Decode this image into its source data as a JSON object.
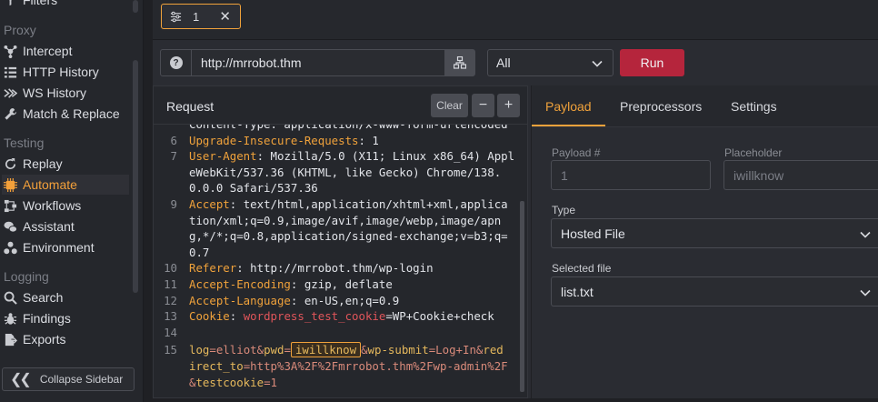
{
  "sidebar": {
    "partial_top_item": "Filters",
    "sections": {
      "proxy": "Proxy",
      "testing": "Testing",
      "logging": "Logging"
    },
    "items": [
      {
        "label": "Intercept",
        "icon": "proxy-icon"
      },
      {
        "label": "HTTP History",
        "icon": "list-icon"
      },
      {
        "label": "WS History",
        "icon": "websocket-icon"
      },
      {
        "label": "Match & Replace",
        "icon": "wrench-icon"
      },
      {
        "label": "Replay",
        "icon": "replay-icon"
      },
      {
        "label": "Automate",
        "icon": "automate-icon",
        "active": true
      },
      {
        "label": "Workflows",
        "icon": "workflow-icon"
      },
      {
        "label": "Assistant",
        "icon": "chat-icon"
      },
      {
        "label": "Environment",
        "icon": "environment-icon"
      },
      {
        "label": "Search",
        "icon": "search-icon"
      },
      {
        "label": "Findings",
        "icon": "bug-icon"
      },
      {
        "label": "Exports",
        "icon": "export-icon"
      }
    ],
    "collapse_label": "Collapse Sidebar"
  },
  "tabs": [
    {
      "label": "1",
      "icon": "sliders-icon"
    }
  ],
  "toolbar": {
    "url": "http://mrrobot.thm",
    "help_glyph": "?",
    "filter_value": "All",
    "run_label": "Run"
  },
  "request": {
    "title": "Request",
    "clear_label": "Clear",
    "minus_label": "−",
    "plus_label": "+",
    "top_partial": "Content-Type: application/x-www-form-urlencoded",
    "lines": [
      {
        "n": "6",
        "key": "Upgrade-Insecure-Requests",
        "value": " 1"
      },
      {
        "n": "7",
        "key": "User-Agent",
        "value": " Mozilla/5.0 (X11; Linux x86_64) Appl"
      },
      {
        "n": "",
        "key": "",
        "value": "eWebKit/537.36 (KHTML, like Gecko) Chrome/138."
      },
      {
        "n": "",
        "key": "",
        "value": "0.0.0 Safari/537.36"
      },
      {
        "n": "9",
        "key": "Accept",
        "value": " text/html,application/xhtml+xml,applica"
      },
      {
        "n": "",
        "key": "",
        "value": "tion/xml;q=0.9,image/avif,image/webp,image/apn"
      },
      {
        "n": "",
        "key": "",
        "value": "g,*/*;q=0.8,application/signed-exchange;v=b3;q="
      },
      {
        "n": "",
        "key": "",
        "value": "0.7"
      },
      {
        "n": "10",
        "key": "Referer",
        "value": " http://mrrobot.thm/wp-login"
      },
      {
        "n": "11",
        "key": "Accept-Encoding",
        "value": " gzip, deflate"
      },
      {
        "n": "12",
        "key": "Accept-Language",
        "value": " en-US,en;q=0.9"
      }
    ],
    "cookie_line": {
      "n": "13",
      "key": "Cookie",
      "cookie_name": "wordpress_test_cookie",
      "cookie_value": "=WP+Cookie+check"
    },
    "empty_line": {
      "n": "14"
    },
    "body_line": {
      "n": "15",
      "p1": "log",
      "v1": "=elliot&",
      "p2": "pwd",
      "eq2": "=",
      "marker": "iwillknow",
      "amp": "&",
      "p3": "wp-submit",
      "v3": "=Log+In&",
      "p4_a": "red",
      "p4_b": "irect_to",
      "v4": "=http%3A%2F%2Fmrrobot.thm%2Fwp-admin%2F",
      "v5": "&",
      "p5": "testcookie",
      "v6": "=1"
    }
  },
  "right_panel": {
    "tabs": [
      "Payload",
      "Preprocessors",
      "Settings"
    ],
    "payload_num_label": "Payload #",
    "payload_num_value": "1",
    "placeholder_label": "Placeholder",
    "placeholder_value": "iwillknow",
    "type_label": "Type",
    "type_value": "Hosted File",
    "file_label": "Selected file",
    "file_value": "list.txt"
  },
  "colors": {
    "accent": "#f0a23b",
    "run": "#b5253c"
  }
}
